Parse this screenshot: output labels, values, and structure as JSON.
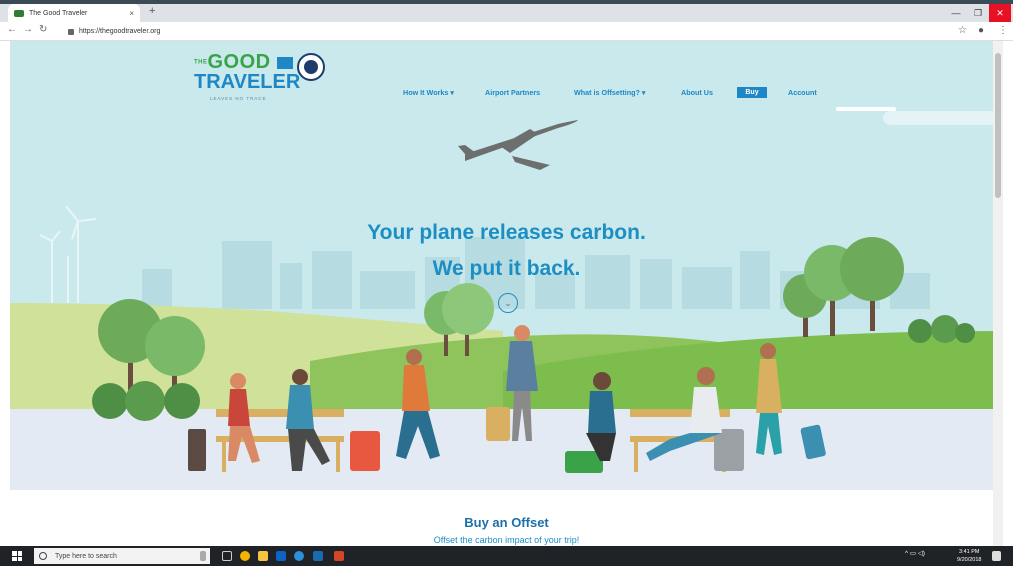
{
  "browser": {
    "tab_title": "The Good Traveler",
    "tab_close": "×",
    "new_tab": "+",
    "url": "https://thegoodtraveler.org"
  },
  "site": {
    "logo": {
      "line1": "GOOD",
      "the": "THE",
      "line2": "TRAVELER",
      "tagline": "LEAVES NO TRACE"
    },
    "nav": {
      "how_it_works": "How It Works ▾",
      "airport_partners": "Airport Partners",
      "what_is_offsetting": "What is Offsetting? ▾",
      "about_us": "About Us",
      "buy": "Buy",
      "account": "Account"
    },
    "hero": {
      "line1": "Your plane releases carbon.",
      "line2": "We put it back."
    },
    "offset": {
      "title": "Buy an Offset",
      "subtitle": "Offset the carbon impact of your trip!"
    }
  },
  "taskbar": {
    "search_placeholder": "Type here to search",
    "time": "3:41 PM",
    "date": "9/20/2018"
  },
  "colors": {
    "brand_blue": "#1e88c7",
    "brand_green": "#3aa34a",
    "sky": "#c9e9ec"
  }
}
